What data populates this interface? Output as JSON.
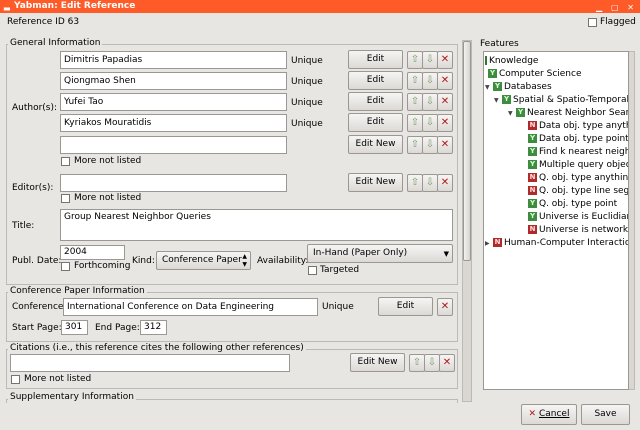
{
  "window": {
    "title": "Yabman: Edit Reference"
  },
  "header": {
    "reference_id": "Reference ID 63",
    "flagged_label": "Flagged"
  },
  "general": {
    "title": "General Information",
    "authors_label": "Author(s):",
    "authors": [
      {
        "name": "Dimitris Papadias",
        "status": "Unique"
      },
      {
        "name": "Qiongmao Shen",
        "status": "Unique"
      },
      {
        "name": "Yufei Tao",
        "status": "Unique"
      },
      {
        "name": "Kyriakos Mouratidis",
        "status": "Unique"
      }
    ],
    "edit_label": "Edit",
    "edit_new_label": "Edit New",
    "more_not_listed": "More not listed",
    "editors_label": "Editor(s):",
    "title_label": "Title:",
    "title_value": "Group Nearest Neighbor Queries",
    "publ_date_label": "Publ. Date:",
    "publ_date_value": "2004",
    "forthcoming_label": "Forthcoming",
    "kind_label": "Kind:",
    "kind_value": "Conference Paper",
    "availability_label": "Availability:",
    "availability_value": "In-Hand (Paper Only)",
    "targeted_label": "Targeted"
  },
  "conference": {
    "title": "Conference Paper Information",
    "conference_label": "Conference:",
    "conference_value": "International Conference on Data Engineering",
    "status": "Unique",
    "edit_label": "Edit",
    "start_page_label": "Start Page:",
    "start_page_value": "301",
    "end_page_label": "End Page:",
    "end_page_value": "312"
  },
  "citations": {
    "title": "Citations (i.e., this reference cites the following other references)",
    "edit_new_label": "Edit New",
    "more_not_listed": "More not listed"
  },
  "supplementary": {
    "title": "Supplementary Information"
  },
  "features": {
    "title": "Features",
    "items": [
      {
        "label": "Knowledge",
        "badge": "",
        "indent": 0,
        "arrow": ""
      },
      {
        "label": "Computer Science",
        "badge": "Y",
        "indent": 0,
        "arrow": ""
      },
      {
        "label": "Databases",
        "badge": "Y",
        "indent": 1,
        "arrow": "▼"
      },
      {
        "label": "Spatial & Spatio-Temporal",
        "badge": "Y",
        "indent": 2,
        "arrow": "▼"
      },
      {
        "label": "Nearest Neighbor Search",
        "badge": "Y",
        "indent": 3,
        "arrow": "▼"
      },
      {
        "label": "Data obj. type anything",
        "badge": "N",
        "indent": 4,
        "arrow": ""
      },
      {
        "label": "Data obj. type point",
        "badge": "Y",
        "indent": 4,
        "arrow": ""
      },
      {
        "label": "Find k nearest neighbors",
        "badge": "Y",
        "indent": 4,
        "arrow": ""
      },
      {
        "label": "Multiple query objects",
        "badge": "Y",
        "indent": 4,
        "arrow": ""
      },
      {
        "label": "Q. obj. type anything",
        "badge": "N",
        "indent": 4,
        "arrow": ""
      },
      {
        "label": "Q. obj. type line segment",
        "badge": "N",
        "indent": 4,
        "arrow": ""
      },
      {
        "label": "Q. obj. type point",
        "badge": "Y",
        "indent": 4,
        "arrow": ""
      },
      {
        "label": "Universe is Euclidian",
        "badge": "Y",
        "indent": 4,
        "arrow": ""
      },
      {
        "label": "Universe is network",
        "badge": "N",
        "indent": 4,
        "arrow": ""
      },
      {
        "label": "Human-Computer Interaction",
        "badge": "N",
        "indent": 0,
        "arrow": "▶"
      }
    ]
  },
  "footer": {
    "cancel_label": "Cancel",
    "save_label": "Save"
  },
  "icons": {
    "up": "up-arrow-icon",
    "down": "down-arrow-icon",
    "delete": "delete-x-icon"
  }
}
